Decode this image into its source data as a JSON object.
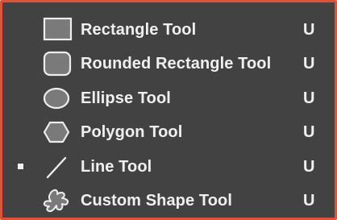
{
  "menu": {
    "items": [
      {
        "label": "Rectangle Tool",
        "shortcut": "U",
        "icon": "rectangle-icon",
        "active": false
      },
      {
        "label": "Rounded Rectangle Tool",
        "shortcut": "U",
        "icon": "rounded-rectangle-icon",
        "active": false
      },
      {
        "label": "Ellipse Tool",
        "shortcut": "U",
        "icon": "ellipse-icon",
        "active": false
      },
      {
        "label": "Polygon Tool",
        "shortcut": "U",
        "icon": "polygon-icon",
        "active": false
      },
      {
        "label": "Line Tool",
        "shortcut": "U",
        "icon": "line-icon",
        "active": true
      },
      {
        "label": "Custom Shape Tool",
        "shortcut": "U",
        "icon": "custom-shape-icon",
        "active": false
      }
    ]
  },
  "colors": {
    "background": "#424242",
    "border": "#e0533a",
    "text": "#f0f0f0",
    "icon_fill": "#7a7a7a"
  }
}
